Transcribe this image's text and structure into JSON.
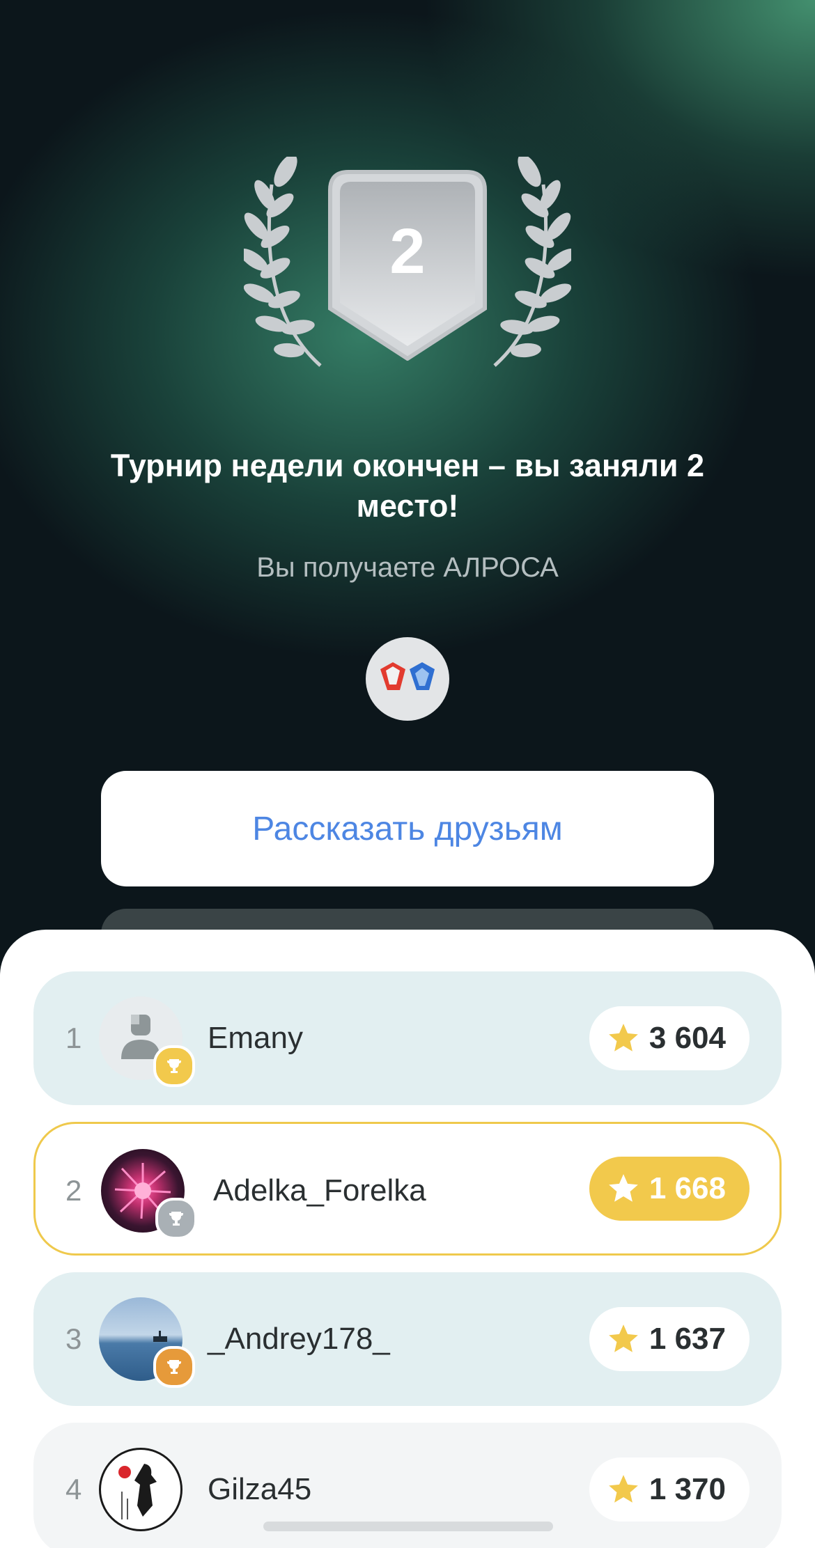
{
  "result": {
    "place": "2",
    "title": "Турнир недели окончен – вы заняли 2 место!",
    "subtitle": "Вы получаете АЛРОСА"
  },
  "actions": {
    "share_label": "Рассказать друзьям"
  },
  "leaderboard": [
    {
      "rank": "1",
      "name": "Emany",
      "score": "3 604",
      "medal": "gold-trophy-icon",
      "highlighted": false
    },
    {
      "rank": "2",
      "name": "Adelka_Forelka",
      "score": "1 668",
      "medal": "silver-trophy-icon",
      "highlighted": true
    },
    {
      "rank": "3",
      "name": "_Andrey178_",
      "score": "1 637",
      "medal": "bronze-trophy-icon",
      "highlighted": false
    },
    {
      "rank": "4",
      "name": "Gilza45",
      "score": "1 370",
      "medal": "",
      "highlighted": false
    }
  ],
  "colors": {
    "accent_blue": "#4d86e3",
    "gold": "#f2c94c",
    "row_bg": "#e2eff1"
  }
}
